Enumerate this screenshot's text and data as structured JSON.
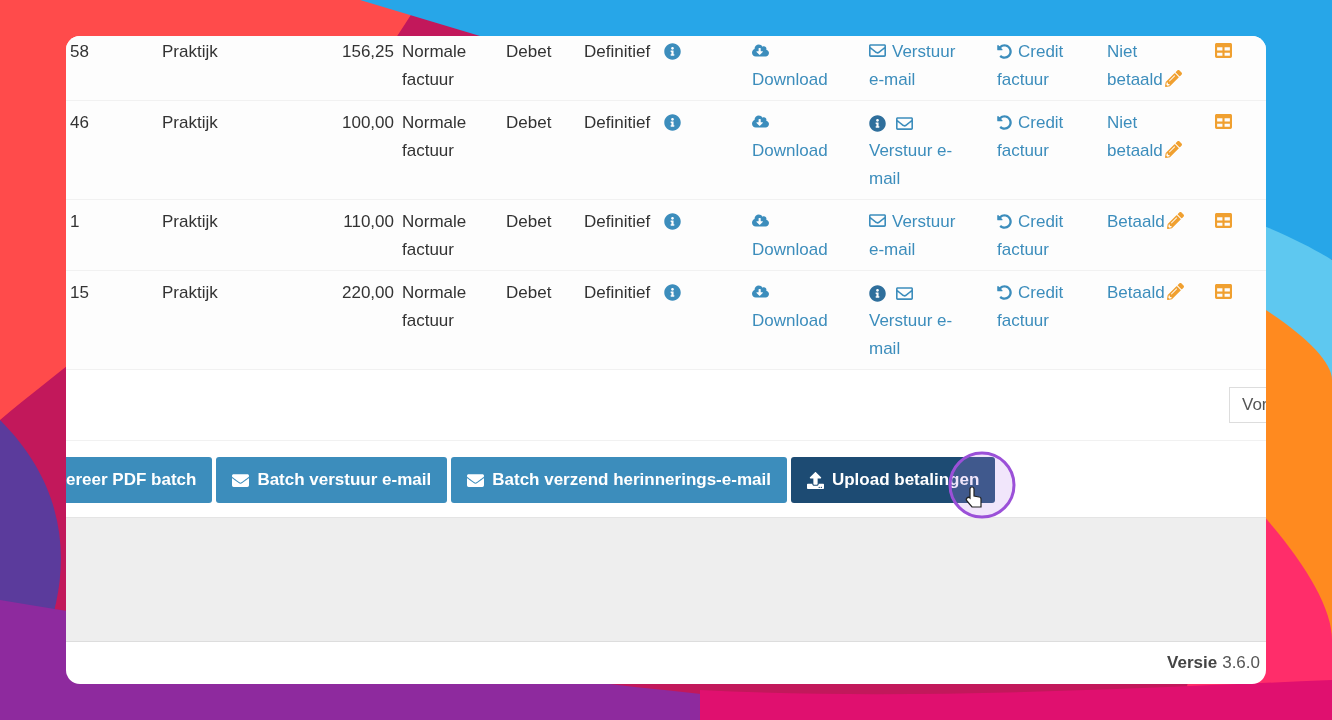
{
  "rows": [
    {
      "id": "58",
      "name": "Praktijk",
      "amount": "156,25",
      "type": "Normale factuur",
      "side": "Debet",
      "status": "Definitief",
      "download": "Download",
      "email": {
        "label": "Verstuur e-mail",
        "info": false
      },
      "credit": "Credit factuur",
      "payment": "Niet betaald"
    },
    {
      "id": "46",
      "name": "Praktijk",
      "amount": "100,00",
      "type": "Normale factuur",
      "side": "Debet",
      "status": "Definitief",
      "download": "Download",
      "email": {
        "label": "Verstuur e-mail",
        "info": true
      },
      "credit": "Credit factuur",
      "payment": "Niet betaald"
    },
    {
      "id": "1",
      "name": "Praktijk",
      "amount": "110,00",
      "type": "Normale factuur",
      "side": "Debet",
      "status": "Definitief",
      "download": "Download",
      "email": {
        "label": "Verstuur e-mail",
        "info": false
      },
      "credit": "Credit factuur",
      "payment": "Betaald"
    },
    {
      "id": "15",
      "name": "Praktijk",
      "amount": "220,00",
      "type": "Normale factuur",
      "side": "Debet",
      "status": "Definitief",
      "download": "Download",
      "email": {
        "label": "Verstuur e-mail",
        "info": true
      },
      "credit": "Credit factuur",
      "payment": "Betaald"
    }
  ],
  "select": {
    "value": "Vor"
  },
  "buttons": [
    {
      "label": "ereer PDF batch",
      "kind": "plain",
      "active": false
    },
    {
      "label": "Batch verstuur e-mail",
      "kind": "email",
      "active": false
    },
    {
      "label": "Batch verzend herinnerings-e-mail",
      "kind": "email",
      "active": false
    },
    {
      "label": "Upload betalingen",
      "kind": "upload",
      "active": true
    }
  ],
  "footer": {
    "label": "Versie",
    "version": "3.6.0"
  }
}
